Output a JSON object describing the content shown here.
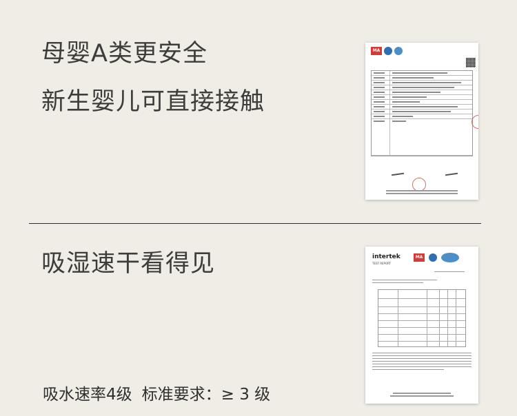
{
  "section1": {
    "headline_1": "母婴A类更安全",
    "headline_2": "新生婴儿可直接接触"
  },
  "section2": {
    "headline": "吸湿速干看得见",
    "rate_label": "吸水速率4级",
    "standard_label": "标准要求：≥ 3 级"
  },
  "report1": {
    "logos": [
      "MA",
      "CNAS"
    ],
    "brand_color": "#d43b36"
  },
  "report2": {
    "brand": "intertek",
    "title": "TEST REPORT",
    "logos": [
      "MA",
      "CNAS"
    ]
  }
}
